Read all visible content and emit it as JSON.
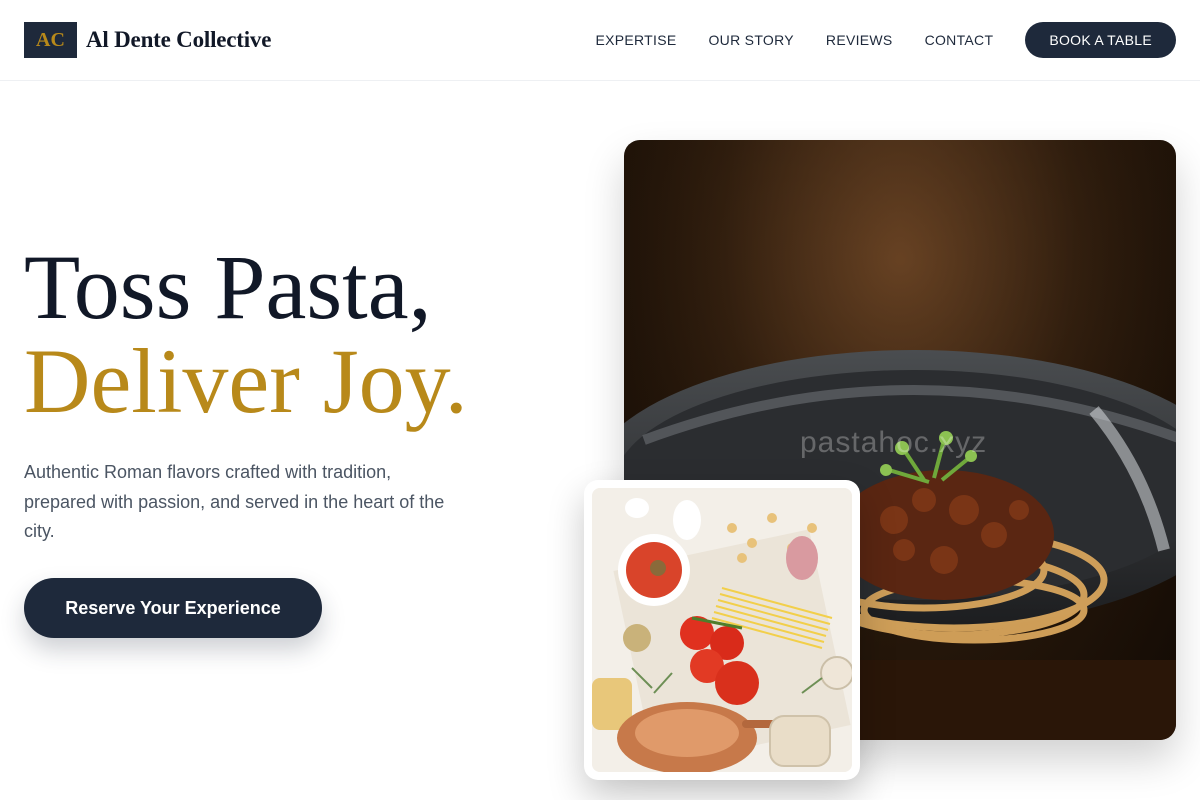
{
  "brand": {
    "logo_text": "AC",
    "name": "Al Dente Collective"
  },
  "nav": {
    "links": [
      "EXPERTISE",
      "OUR STORY",
      "REVIEWS",
      "CONTACT"
    ],
    "cta": "BOOK A TABLE"
  },
  "hero": {
    "headline_line1": "Toss Pasta,",
    "headline_line2": "Deliver Joy.",
    "description": "Authentic Roman flavors crafted with tradition, prepared with passion, and served in the heart of the city.",
    "button": "Reserve Your Experience"
  },
  "images": {
    "main_watermark": "pastahoc.xyz"
  },
  "colors": {
    "navy": "#1e293b",
    "gold": "#b8891a"
  }
}
